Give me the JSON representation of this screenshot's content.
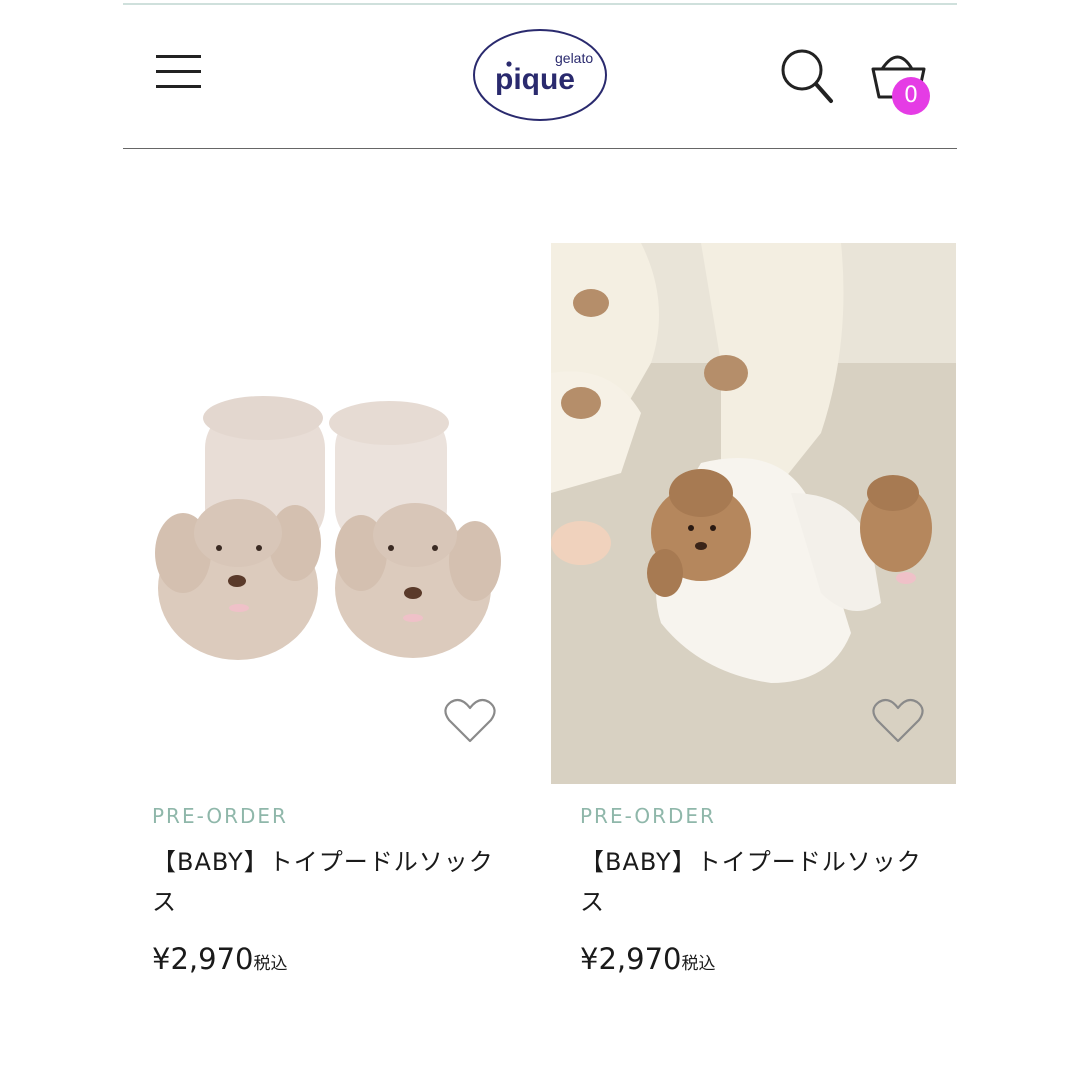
{
  "header": {
    "logo_small": "gelato",
    "logo_main": "pique",
    "cart_count": "0"
  },
  "products": [
    {
      "badge": "PRE-ORDER",
      "title": "【BABY】トイプードルソックス",
      "price": "¥2,970",
      "tax": "税込"
    },
    {
      "badge": "PRE-ORDER",
      "title": "【BABY】トイプードルソックス",
      "price": "¥2,970",
      "tax": "税込"
    }
  ],
  "icons": {
    "menu": "hamburger-icon",
    "search": "search-icon",
    "cart": "cart-icon",
    "favorite": "heart-icon"
  },
  "colors": {
    "accent_badge": "#e53ce5",
    "preorder": "#8fb7aa",
    "logo": "#2a2a6e"
  }
}
